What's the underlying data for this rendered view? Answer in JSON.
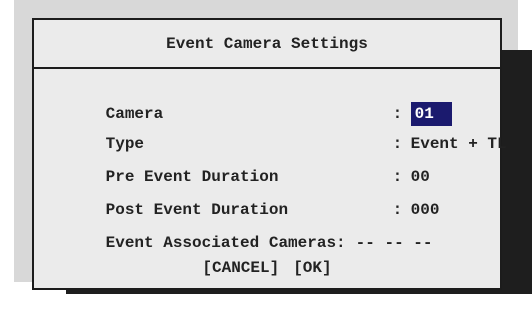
{
  "dialog": {
    "title": "Event Camera Settings",
    "rows": [
      {
        "label": "Camera",
        "value": "01"
      },
      {
        "label": "Type",
        "value": "Event + TL"
      },
      {
        "label": "Pre Event Duration",
        "value": "00"
      },
      {
        "label": "Post Event Duration",
        "value": "000"
      },
      {
        "label": "Event Associated Cameras",
        "value": "-- -- --"
      }
    ],
    "separator": ":",
    "cancel_label": "[CANCEL]",
    "ok_label": "[OK]"
  },
  "colors": {
    "selection_bg": "#1b1a6e",
    "dialog_bg": "#ebebeb",
    "backdrop": "#d8d8d8",
    "shadow": "#1e1e1e"
  }
}
